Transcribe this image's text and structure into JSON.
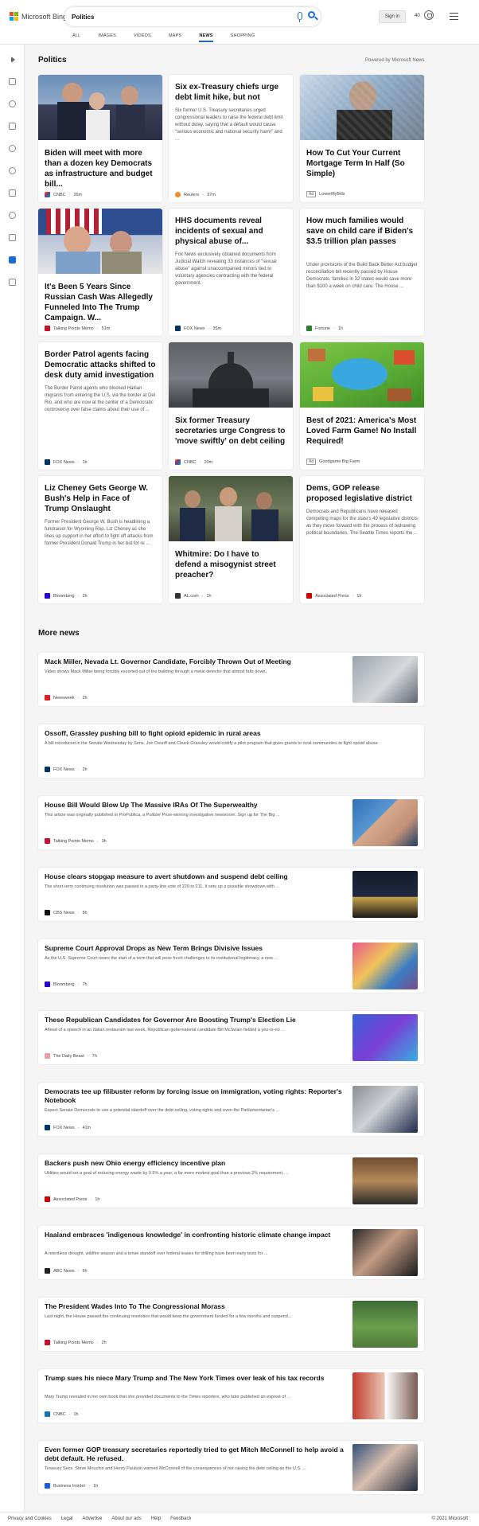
{
  "header": {
    "brand": "Microsoft Bing",
    "query": "Politics",
    "signin": "Sign in",
    "points": "40"
  },
  "tabs": [
    "ALL",
    "IMAGES",
    "VIDEOS",
    "MAPS",
    "NEWS",
    "SHOPPING"
  ],
  "section_title": "Politics",
  "powered_by": "Powered by Microsoft News",
  "cards": [
    {
      "title": "Biden will meet with more than a dozen key Democrats as infrastructure and budget bill...",
      "snippet": "",
      "source": "CNBC",
      "time": "26m",
      "color": "#1c74b8"
    },
    {
      "title": "Six ex-Treasury chiefs urge debt limit hike, but not Mnuchin",
      "snippet": "Six former U.S. Treasury secretaries urged congressional leaders to raise the federal debt limit without delay, saying that a default would cause \"serious economic and national security harm\" and ...",
      "source": "Reuters",
      "time": "37m",
      "color": "#f28c28"
    },
    {
      "title": "How To Cut Your Current Mortgage Term In Half (So Simple)",
      "snippet": "",
      "source": "LowerMyBills",
      "time": "",
      "ad": "Ad",
      "color": "#1b3d74"
    },
    {
      "title": "It's Been 5 Years Since Russian Cash Was Allegedly Funneled Into The Trump Campaign. W...",
      "snippet": "",
      "source": "Talking Points Memo",
      "time": "51m",
      "color": "#c8102e"
    },
    {
      "title": "HHS documents reveal incidents of sexual and physical abuse of...",
      "snippet": "Fox News exclusively obtained documents from Judicial Watch revealing 33 instances of \"sexual abuse\" against unaccompanied minors tied to voluntary agencies contracting with the federal government.",
      "source": "FOX News",
      "time": "35m",
      "color": "#003366"
    },
    {
      "title": "How much families would save on child care if Biden's $3.5 trillion plan passes",
      "snippet": "Under provisions of the Build Back Better Act budget reconciliation bill recently passed by House Democrats, families in 32 states would save more than $100 a week on child care. The House ...",
      "source": "Fortune",
      "time": "1h",
      "color": "#2e7d32"
    },
    {
      "title": "Border Patrol agents facing Democratic attacks shifted to desk duty amid investigation",
      "snippet": "The Border Patrol agents who blocked Haitian migrants from entering the U.S. via the border at Del Rio, and who are now at the center of a Democratic controversy over false claims about their use of ...",
      "source": "FOX News",
      "time": "1h",
      "color": "#003366"
    },
    {
      "title": "Six former Treasury secretaries urge Congress to 'move swiftly' on debt ceiling",
      "snippet": "",
      "source": "CNBC",
      "time": "20m",
      "color": "#1c74b8"
    },
    {
      "title": "Best of 2021: America's Most Loved Farm Game! No Install Required!",
      "snippet": "",
      "source": "Goodgame Big Farm",
      "time": "",
      "ad": "Ad",
      "color": "#6a9f2a"
    },
    {
      "title": "Liz Cheney Gets George W. Bush's Help in Face of Trump Onslaught",
      "snippet": "Former President George W. Bush is headlining a fundraiser for Wyoming Rep. Liz Cheney as she lines up support in her effort to fight off attacks from former President Donald Trump in her bid for re ...",
      "source": "Bloomberg",
      "time": "2h",
      "color": "#2800d7"
    },
    {
      "title": "Whitmire: Do I have to defend a misogynist street preacher?",
      "snippet": "",
      "source": "AL.com",
      "time": "1h",
      "color": "#333333"
    },
    {
      "title": "Dems, GOP release proposed legislative district maps for WA",
      "snippet": "Democrats and Republicans have released competing maps for the state's 49 legislative districts as they move forward with the process of redrawing political boundaries. The Seattle Times reports the ...",
      "source": "Associated Press",
      "time": "1h",
      "color": "#cc0000"
    }
  ],
  "more_title": "More news",
  "rows": [
    {
      "title": "Mack Miller, Nevada Lt. Governor Candidate, Forcibly Thrown Out of Meeting",
      "snippet": "Video shows Mack Miller being forcibly escorted out of the building through a metal detector that almost falls down.",
      "source": "Newsweek",
      "time": "2h",
      "color": "#e31b23"
    },
    {
      "title": "Ossoff, Grassley pushing bill to fight opioid epidemic in rural areas",
      "snippet": "A bill introduced in the Senate Wednesday by Sens. Jon Ossoff and Chuck Grassley would codify a pilot program that gives grants to rural communities to fight opioid abuse.",
      "source": "FOX News",
      "time": "2h",
      "color": "#003366"
    },
    {
      "title": "House Bill Would Blow Up The Massive IRAs Of The Superwealthy",
      "snippet": "This article was originally published in ProPublica, a Pulitzer Prize-winning investigative newsroom. Sign up for The Big ...",
      "source": "Talking Points Memo",
      "time": "3h",
      "color": "#c8102e"
    },
    {
      "title": "House clears stopgap measure to avert shutdown and suspend debt ceiling",
      "snippet": "The short-term continuing resolution was passed in a party-line vote of 220 to 211. It sets up a possible showdown with ...",
      "source": "CBS News",
      "time": "5h",
      "color": "#111111"
    },
    {
      "title": "Supreme Court Approval Drops as New Term Brings Divisive Issues",
      "snippet": "As the U.S. Supreme Court nears the start of a term that will pose fresh challenges to its institutional legitimacy, a new ...",
      "source": "Bloomberg",
      "time": "7h",
      "color": "#2800d7"
    },
    {
      "title": "These Republican Candidates for Governor Are Boosting Trump's Election Lie",
      "snippet": "Ahead of a speech in an Italian restaurant last week, Republican gubernatorial candidate Bill McSwain fielded a yes-or-no ...",
      "source": "The Daily Beast",
      "time": "7h",
      "color": "#e8a0a0"
    },
    {
      "title": "Democrats tee up filibuster reform by forcing issue on immigration, voting rights: Reporter's Notebook",
      "snippet": "Expect Senate Democrats to use a potential standoff over the debt ceiling, voting rights and even the Parliamentarian's ...",
      "source": "FOX News",
      "time": "41m",
      "color": "#003366"
    },
    {
      "title": "Backers push new Ohio energy efficiency incentive plan",
      "snippet": "Utilities would set a goal of reducing energy waste by 0.5% a year, a far more modest goal than a previous 2% requirement, ...",
      "source": "Associated Press",
      "time": "1h",
      "color": "#cc0000"
    },
    {
      "title": "Haaland embraces 'indigenous knowledge' in confronting historic climate change impact",
      "snippet": "A relentless drought, wildfire season and a tense standoff over federal leases for drilling have been early tests for ...",
      "source": "ABC News",
      "time": "5h",
      "color": "#222222"
    },
    {
      "title": "The President Wades Into To The Congressional Morass",
      "snippet": "Last night, the House passed the continuing resolution that would keep the government funded for a few months and suspend...",
      "source": "Talking Points Memo",
      "time": "2h",
      "color": "#c8102e"
    },
    {
      "title": "Trump sues his niece Mary Trump and The New York Times over leak of his tax records",
      "snippet": "Mary Trump revealed in her own book that she provided documents to the Times reporters, who later published an exposé of ...",
      "source": "CNBC",
      "time": "1h",
      "color": "#1c74b8"
    },
    {
      "title": "Even former GOP treasury secretaries reportedly tried to get Mitch McConnell to help avoid a debt default. He refused.",
      "snippet": "Treasury Secs. Steve Mnuchin and Henry Paulson warned McConnell of the consequences of not raising the debt ceiling as the U.S. ...",
      "source": "Business Insider",
      "time": "1h",
      "color": "#1f5fd6"
    }
  ],
  "footer": {
    "links": [
      "Privacy and Cookies",
      "Legal",
      "Advertise",
      "About our ads",
      "Help",
      "Feedback"
    ],
    "copyright": "© 2021 Microsoft"
  }
}
